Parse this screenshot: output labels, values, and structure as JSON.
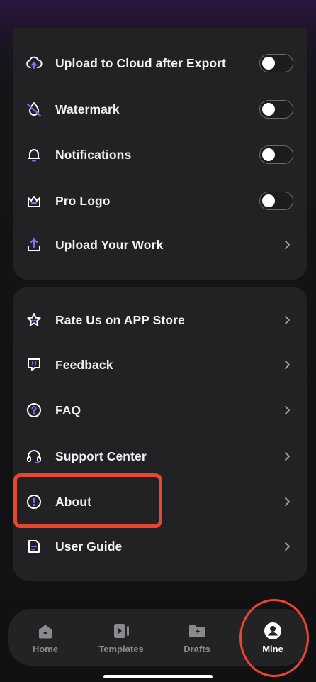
{
  "settings_top": [
    {
      "id": "upload-cloud",
      "label": "Upload to Cloud after Export",
      "icon": "cloud-upload-icon",
      "control": "toggle",
      "on": false
    },
    {
      "id": "watermark",
      "label": "Watermark",
      "icon": "watermark-icon",
      "control": "toggle",
      "on": false
    },
    {
      "id": "notifications",
      "label": "Notifications",
      "icon": "bell-icon",
      "control": "toggle",
      "on": false
    },
    {
      "id": "pro-logo",
      "label": "Pro Logo",
      "icon": "crown-icon",
      "control": "toggle",
      "on": false
    },
    {
      "id": "upload-work",
      "label": "Upload Your Work",
      "icon": "upload-icon",
      "control": "chevron"
    }
  ],
  "settings_bottom": [
    {
      "id": "rate-us",
      "label": "Rate Us on APP Store",
      "icon": "star-icon",
      "control": "chevron"
    },
    {
      "id": "feedback",
      "label": "Feedback",
      "icon": "chat-icon",
      "control": "chevron"
    },
    {
      "id": "faq",
      "label": "FAQ",
      "icon": "question-icon",
      "control": "chevron"
    },
    {
      "id": "support",
      "label": "Support Center",
      "icon": "headset-icon",
      "control": "chevron"
    },
    {
      "id": "about",
      "label": "About",
      "icon": "info-icon",
      "control": "chevron"
    },
    {
      "id": "user-guide",
      "label": "User Guide",
      "icon": "document-icon",
      "control": "chevron"
    }
  ],
  "tabbar": [
    {
      "id": "home",
      "label": "Home",
      "icon": "home-icon",
      "active": false
    },
    {
      "id": "templates",
      "label": "Templates",
      "icon": "templates-icon",
      "active": false
    },
    {
      "id": "drafts",
      "label": "Drafts",
      "icon": "drafts-icon",
      "active": false
    },
    {
      "id": "mine",
      "label": "Mine",
      "icon": "user-icon",
      "active": true
    }
  ],
  "colors": {
    "background": "#111113",
    "card": "#222224",
    "accent": "#8b6cf0",
    "annotation": "#e9452f"
  }
}
